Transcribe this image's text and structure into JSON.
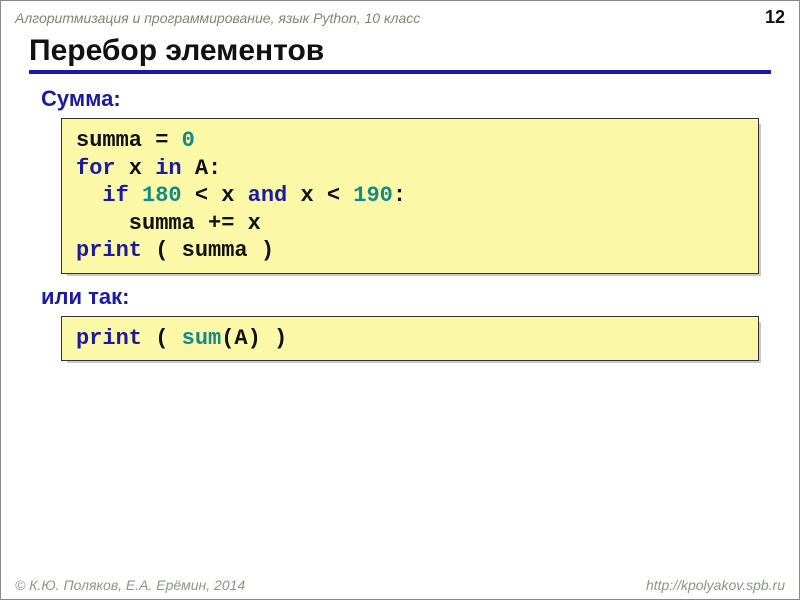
{
  "header": {
    "course": "Алгоритмизация и программирование, язык Python, 10 класс",
    "page": "12"
  },
  "title": "Перебор элементов",
  "labels": {
    "sum": "Сумма:",
    "or": "или так:"
  },
  "code1": {
    "t1a": "summa = ",
    "t1b": "0",
    "t2a": "for",
    "t2b": " x ",
    "t2c": "in",
    "t2d": " A:",
    "t3a": "  ",
    "t3b": "if",
    "t3c": " ",
    "t3d": "180",
    "t3e": " < x ",
    "t3f": "and",
    "t3g": " x < ",
    "t3h": "190",
    "t3i": ":",
    "t4": "    summa += x",
    "t5a": "print",
    "t5b": " ( summa )"
  },
  "code2": {
    "t1a": "print",
    "t1b": " ( ",
    "t1c": "sum",
    "t1d": "(A) )"
  },
  "footer": {
    "left": "© К.Ю. Поляков, Е.А. Ерёмин, 2014",
    "right": "http://kpolyakov.spb.ru"
  }
}
